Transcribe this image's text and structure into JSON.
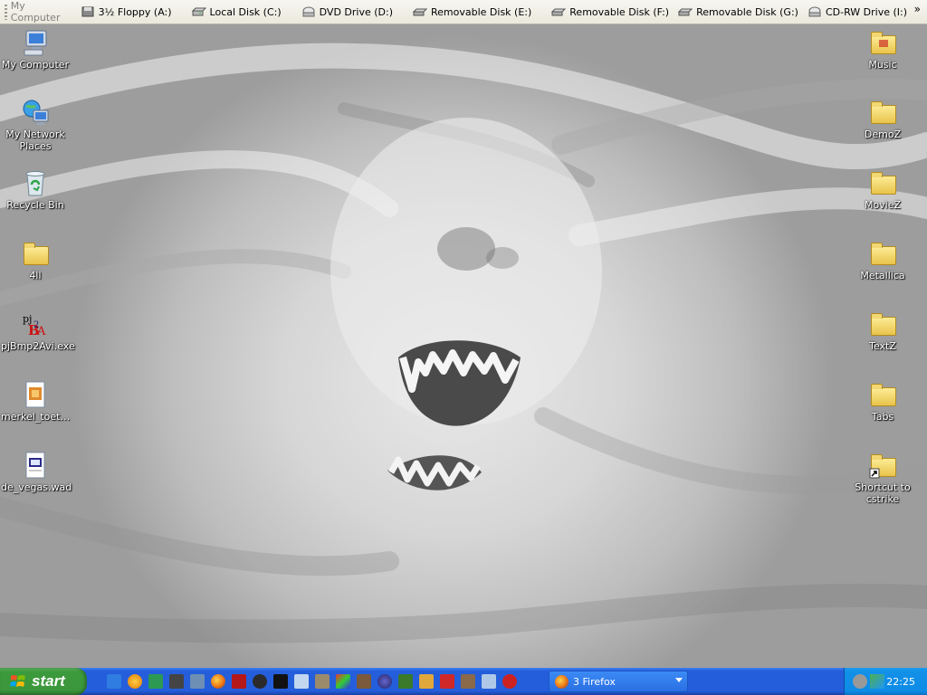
{
  "drivebar": {
    "title": "My Computer",
    "drives": [
      {
        "label": "3½ Floppy (A:)",
        "icon": "floppy-drive-icon"
      },
      {
        "label": "Local Disk (C:)",
        "icon": "hard-disk-icon"
      },
      {
        "label": "DVD Drive (D:)",
        "icon": "dvd-drive-icon"
      },
      {
        "label": "Removable Disk (E:)",
        "icon": "removable-disk-icon"
      },
      {
        "label": "Removable Disk (F:)",
        "icon": "removable-disk-icon"
      },
      {
        "label": "Removable Disk (G:)",
        "icon": "removable-disk-icon"
      },
      {
        "label": "CD-RW Drive (I:)",
        "icon": "cdrw-drive-icon"
      }
    ],
    "overflow_glyph": "»"
  },
  "desktop": {
    "left_icons": [
      {
        "label": "My Computer",
        "icon": "my-computer-icon"
      },
      {
        "label": "My Network Places",
        "icon": "network-places-icon"
      },
      {
        "label": "Recycle Bin",
        "icon": "recycle-bin-icon"
      },
      {
        "label": "4ll",
        "icon": "folder-icon"
      },
      {
        "label": "pjBmp2Avi.exe",
        "icon": "pjbmp2avi-icon"
      },
      {
        "label": "merkel_toet…",
        "icon": "media-file-icon"
      },
      {
        "label": "de_vegas.wad",
        "icon": "wad-file-icon"
      }
    ],
    "right_icons": [
      {
        "label": "Music",
        "icon": "music-folder-icon"
      },
      {
        "label": "DemoZ",
        "icon": "folder-icon"
      },
      {
        "label": "MovieZ",
        "icon": "folder-icon"
      },
      {
        "label": "Metallica",
        "icon": "folder-icon"
      },
      {
        "label": "TextZ",
        "icon": "folder-icon"
      },
      {
        "label": "Tabs",
        "icon": "folder-icon"
      },
      {
        "label": "Shortcut to cstrike",
        "icon": "folder-shortcut-icon"
      }
    ]
  },
  "taskbar": {
    "start_label": "start",
    "quick_launch": [
      "internet-explorer-icon",
      "media-player-icon",
      "lite-icon",
      "headset-icon",
      "ts-icon",
      "firefox-icon",
      "game-icon",
      "steam-icon",
      "console-icon",
      "media-icon",
      "tool-icon",
      "paint-icon",
      "utility-icon",
      "globe-icon",
      "alien-icon",
      "pencil-icon",
      "shell-icon",
      "folder-tool-icon",
      "app-icon"
    ],
    "task_button_label": "3 Firefox",
    "clock": "22:25"
  },
  "colors": {
    "taskbar_blue": "#245edb",
    "start_green": "#3c973c",
    "tray_blue": "#0e8ce6"
  }
}
